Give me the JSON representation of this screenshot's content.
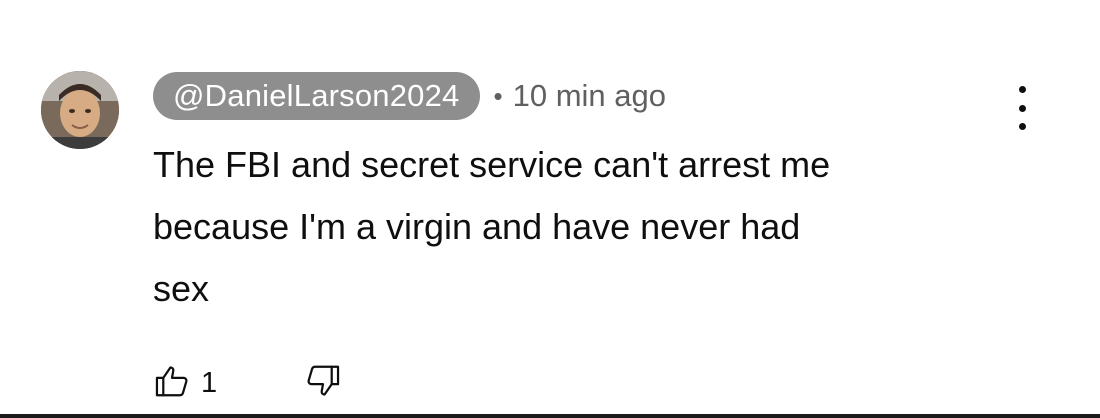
{
  "comment": {
    "author_handle": "@DanielLarson2024",
    "separator": "•",
    "timestamp": "10 min ago",
    "text_lines": [
      "The FBI and secret service can't arrest me",
      "because I'm a virgin and have never had",
      "sex"
    ],
    "like_count": "1"
  },
  "icons": {
    "avatar": "user-avatar-photo",
    "menu": "more-vertical-icon",
    "like": "thumbs-up-icon",
    "dislike": "thumbs-down-icon"
  }
}
